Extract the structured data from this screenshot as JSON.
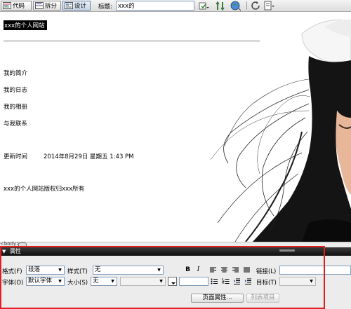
{
  "toolbar": {
    "views": [
      {
        "label": "代码",
        "icon": "code-view-icon"
      },
      {
        "label": "拆分",
        "icon": "split-view-icon"
      },
      {
        "label": "设计",
        "icon": "design-view-icon"
      }
    ],
    "title_label": "标题:",
    "title_value": "xxx的",
    "icons": [
      "file-management-icon",
      "debug-browser-icon",
      "preview-globe-icon",
      "refresh-icon",
      "view-options-icon"
    ]
  },
  "page": {
    "site_title": "xxx的个人网站",
    "nav": [
      "我的简介",
      "我的日志",
      "我的相册",
      "与我联系"
    ],
    "update_label": "更新时间",
    "update_value": "2014年8月29日 星期五 1:43 PM",
    "copyright": "xxx的个人网站版权归xxx所有"
  },
  "tag_bar": {
    "selector": "<body>"
  },
  "properties": {
    "header": "属性",
    "format_label": "格式(F)",
    "format_value": "段落",
    "style_label": "样式(T)",
    "style_value": "无",
    "font_label": "字体(O)",
    "font_value": "默认字体",
    "size_label": "大小(S)",
    "size_value": "无",
    "link_label": "链接(L)",
    "target_label": "目标(T)",
    "page_props_button": "页面属性...",
    "list_item_button": "列表项目",
    "bold": "B",
    "italic": "I"
  },
  "colors": {
    "highlight": "#e02020",
    "panel_header": "#1a1a1a"
  }
}
